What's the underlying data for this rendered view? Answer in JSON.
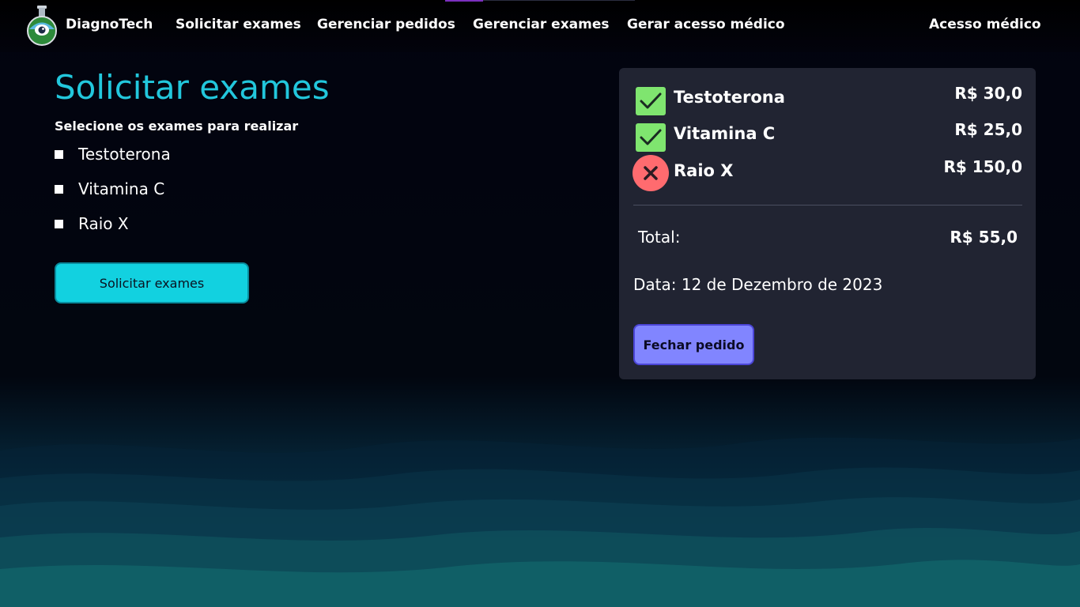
{
  "header": {
    "brand": "DiagnoTech",
    "nav": [
      "Solicitar exames",
      "Gerenciar pedidos",
      "Gerenciar exames",
      "Gerar acesso médico"
    ],
    "right_link": "Acesso médico"
  },
  "main": {
    "title": "Solicitar exames",
    "subtitle": "Selecione os exames para realizar",
    "options": [
      "Testoterona",
      "Vitamina C",
      "Raio X"
    ],
    "submit_label": "Solicitar exames"
  },
  "summary": {
    "items": [
      {
        "name": "Testoterona",
        "price": "R$ 30,0",
        "status": "check-icon"
      },
      {
        "name": "Vitamina C",
        "price": "R$ 25,0",
        "status": "check-icon"
      },
      {
        "name": "Raio X",
        "price": "R$ 150,0",
        "status": "cross-icon"
      }
    ],
    "total_label": "Total:",
    "total_value": "R$ 55,0",
    "date": "Data: 12 de Dezembro de 2023",
    "close_label": "Fechar pedido"
  },
  "colors": {
    "accent": "#22c7dc",
    "button": "#12d1e0",
    "panel": "#212432",
    "ok": "#7fe56f",
    "error": "#ff6b6f",
    "close_button": "#8185ff"
  }
}
